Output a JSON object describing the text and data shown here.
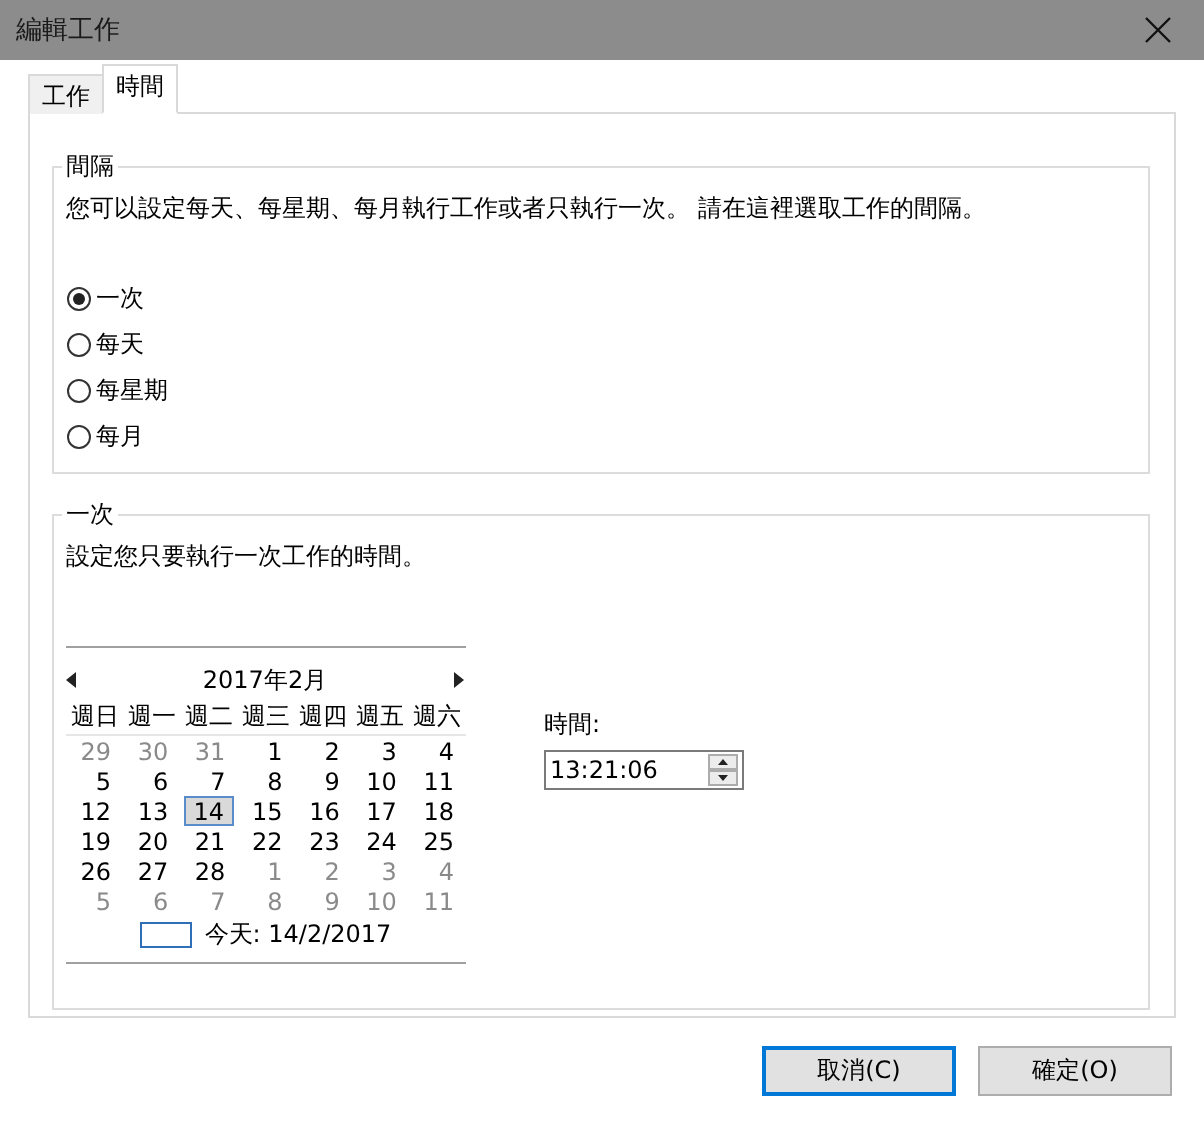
{
  "window": {
    "title": "編輯工作"
  },
  "tabs": [
    {
      "label": "工作",
      "selected": false
    },
    {
      "label": "時間",
      "selected": true
    }
  ],
  "interval_group": {
    "title": "間隔",
    "description": "您可以設定每天、每星期、每月執行工作或者只執行一次。 請在這裡選取工作的間隔。",
    "options": [
      {
        "label": "一次",
        "selected": true
      },
      {
        "label": "每天",
        "selected": false
      },
      {
        "label": "每星期",
        "selected": false
      },
      {
        "label": "每月",
        "selected": false
      }
    ]
  },
  "once_group": {
    "title": "一次",
    "description": "設定您只要執行一次工作的時間。",
    "calendar": {
      "month": "2017年2月",
      "weekdays": [
        "週日",
        "週一",
        "週二",
        "週三",
        "週四",
        "週五",
        "週六"
      ],
      "days": [
        {
          "text": "29",
          "other_month": true,
          "selected": false
        },
        {
          "text": "30",
          "other_month": true,
          "selected": false
        },
        {
          "text": "31",
          "other_month": true,
          "selected": false
        },
        {
          "text": "1",
          "other_month": false,
          "selected": false
        },
        {
          "text": "2",
          "other_month": false,
          "selected": false
        },
        {
          "text": "3",
          "other_month": false,
          "selected": false
        },
        {
          "text": "4",
          "other_month": false,
          "selected": false
        },
        {
          "text": "5",
          "other_month": false,
          "selected": false
        },
        {
          "text": "6",
          "other_month": false,
          "selected": false
        },
        {
          "text": "7",
          "other_month": false,
          "selected": false
        },
        {
          "text": "8",
          "other_month": false,
          "selected": false
        },
        {
          "text": "9",
          "other_month": false,
          "selected": false
        },
        {
          "text": "10",
          "other_month": false,
          "selected": false
        },
        {
          "text": "11",
          "other_month": false,
          "selected": false
        },
        {
          "text": "12",
          "other_month": false,
          "selected": false
        },
        {
          "text": "13",
          "other_month": false,
          "selected": false
        },
        {
          "text": "14",
          "other_month": false,
          "selected": true
        },
        {
          "text": "15",
          "other_month": false,
          "selected": false
        },
        {
          "text": "16",
          "other_month": false,
          "selected": false
        },
        {
          "text": "17",
          "other_month": false,
          "selected": false
        },
        {
          "text": "18",
          "other_month": false,
          "selected": false
        },
        {
          "text": "19",
          "other_month": false,
          "selected": false
        },
        {
          "text": "20",
          "other_month": false,
          "selected": false
        },
        {
          "text": "21",
          "other_month": false,
          "selected": false
        },
        {
          "text": "22",
          "other_month": false,
          "selected": false
        },
        {
          "text": "23",
          "other_month": false,
          "selected": false
        },
        {
          "text": "24",
          "other_month": false,
          "selected": false
        },
        {
          "text": "25",
          "other_month": false,
          "selected": false
        },
        {
          "text": "26",
          "other_month": false,
          "selected": false
        },
        {
          "text": "27",
          "other_month": false,
          "selected": false
        },
        {
          "text": "28",
          "other_month": false,
          "selected": false
        },
        {
          "text": "1",
          "other_month": true,
          "selected": false
        },
        {
          "text": "2",
          "other_month": true,
          "selected": false
        },
        {
          "text": "3",
          "other_month": true,
          "selected": false
        },
        {
          "text": "4",
          "other_month": true,
          "selected": false
        },
        {
          "text": "5",
          "other_month": true,
          "selected": false
        },
        {
          "text": "6",
          "other_month": true,
          "selected": false
        },
        {
          "text": "7",
          "other_month": true,
          "selected": false
        },
        {
          "text": "8",
          "other_month": true,
          "selected": false
        },
        {
          "text": "9",
          "other_month": true,
          "selected": false
        },
        {
          "text": "10",
          "other_month": true,
          "selected": false
        },
        {
          "text": "11",
          "other_month": true,
          "selected": false
        }
      ],
      "today": "今天: 14/2/2017"
    },
    "time_label": "時間:",
    "time_value": "13:21:06"
  },
  "buttons": [
    {
      "label": "取消(C)",
      "default": true
    },
    {
      "label": "確定(O)",
      "default": false
    }
  ]
}
